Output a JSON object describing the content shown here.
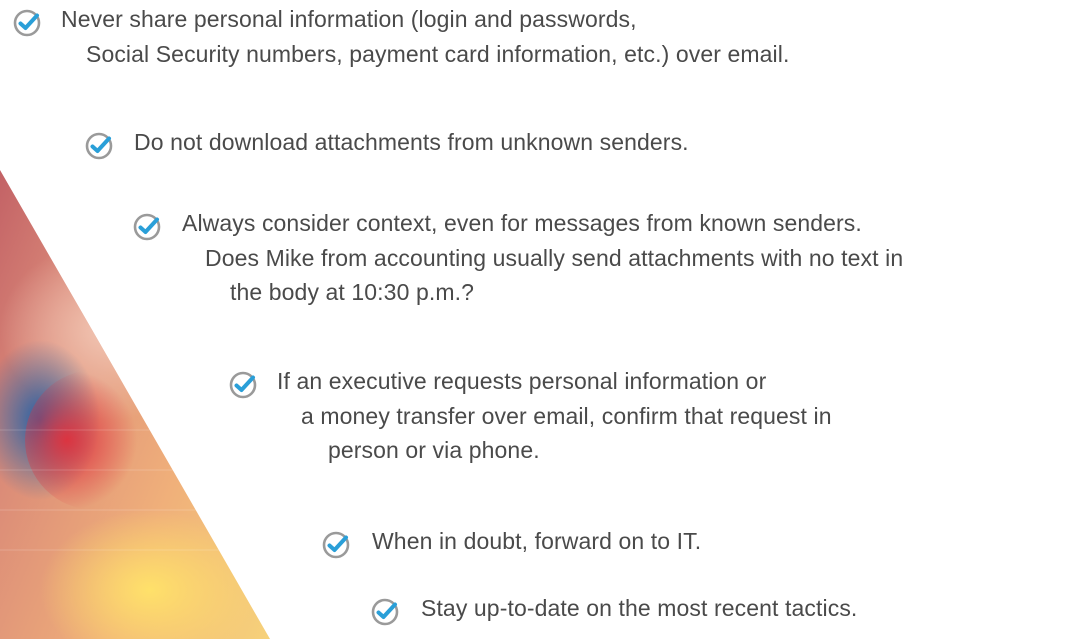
{
  "background_image": {
    "description_icon": "hand-photo-wedge",
    "colors": [
      "#d97a6a",
      "#c93e4a",
      "#1a6bb0",
      "#f2c14e"
    ]
  },
  "tips": [
    {
      "icon": "check-circle-icon",
      "lines": [
        "Never share personal information (login and passwords,",
        "Social Security numbers, payment card information, etc.) over email."
      ]
    },
    {
      "icon": "check-circle-icon",
      "lines": [
        "Do not download attachments from unknown senders."
      ]
    },
    {
      "icon": "check-circle-icon",
      "lines": [
        "Always consider context, even for messages from known senders.",
        "Does Mike from accounting usually send attachments with no text in",
        "the body at 10:30 p.m.?"
      ]
    },
    {
      "icon": "check-circle-icon",
      "lines": [
        "If an executive requests personal information or",
        "a money transfer over email, confirm that request in",
        "person or via phone."
      ]
    },
    {
      "icon": "check-circle-icon",
      "lines": [
        "When in doubt, forward on to IT."
      ]
    },
    {
      "icon": "check-circle-icon",
      "lines": [
        "Stay up-to-date on the most recent tactics."
      ]
    }
  ],
  "colors": {
    "text": "#4a4a4a",
    "check_ring": "#9a9a9a",
    "check_mark": "#2a9fd8"
  }
}
